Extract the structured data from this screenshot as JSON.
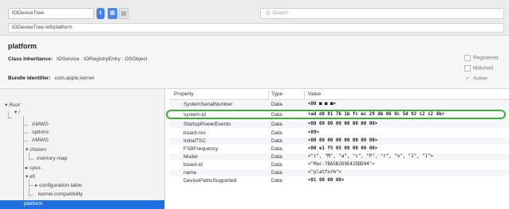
{
  "toolbar": {
    "plane_value": "IODeviceTree",
    "search_placeholder": "Search",
    "path": "IODeviceTree:/efi/platform"
  },
  "header": {
    "title": "platform",
    "class_inheritance_label": "Class Inheritance:",
    "class_inheritance_value": "IOService : IORegistryEntry : OSObject",
    "bundle_identifier_label": "Bundle Identifier:",
    "bundle_identifier_value": "com.apple.kernel",
    "checks": [
      {
        "label": "Registered",
        "checked": false
      },
      {
        "label": "Matched",
        "checked": false
      },
      {
        "label": "Active",
        "checked": true
      }
    ]
  },
  "tree": {
    "root": "Root",
    "slash": "/",
    "items": [
      "AMWG",
      "options",
      "AMWG",
      "chosen",
      "memory-map",
      "cpus",
      "efi",
      "configuration-table",
      "kernel-compatibility",
      "platform"
    ],
    "selected": "platform"
  },
  "table": {
    "headers": {
      "property": "Property",
      "type": "Type",
      "value": "Value"
    },
    "rows": [
      {
        "property": "SystemSerialNumber",
        "type": "Data",
        "value": "<00 ■ ■ ■>"
      },
      {
        "property": "system-id",
        "type": "Data",
        "value": "<ad d8 81 76 1b fc ec 29 db 06 0c 5d 92 c2 c2 4b>"
      },
      {
        "property": "StartupPowerEvents",
        "type": "Data",
        "value": "<00 00 00 00 00 00 00 00>"
      },
      {
        "property": "board-rev",
        "type": "Data",
        "value": "<09>"
      },
      {
        "property": "InitialTSC",
        "type": "Data",
        "value": "<00 00 00 00 00 00 00 00>"
      },
      {
        "property": "FSBFrequency",
        "type": "Data",
        "value": "<00 e1 f5 05 00 00 00 00>"
      },
      {
        "property": "Model",
        "type": "Data",
        "value": "<\"i\", \"M\", \"a\", \"c\", \"P\", \"r\", \"o\", \"1\", \"1\">"
      },
      {
        "property": "board-id",
        "type": "Data",
        "value": "<\"Mac-7BA5B2D9E42DDD94\">"
      },
      {
        "property": "name",
        "type": "Data",
        "value": "<\"platform\">"
      },
      {
        "property": "DevicePathsSupported",
        "type": "Data",
        "value": "<01 00 00 00>"
      }
    ]
  },
  "colors": {
    "selection": "#1f6fe0",
    "highlight_ring": "#3cae3c",
    "accent": "#3f80f0"
  }
}
